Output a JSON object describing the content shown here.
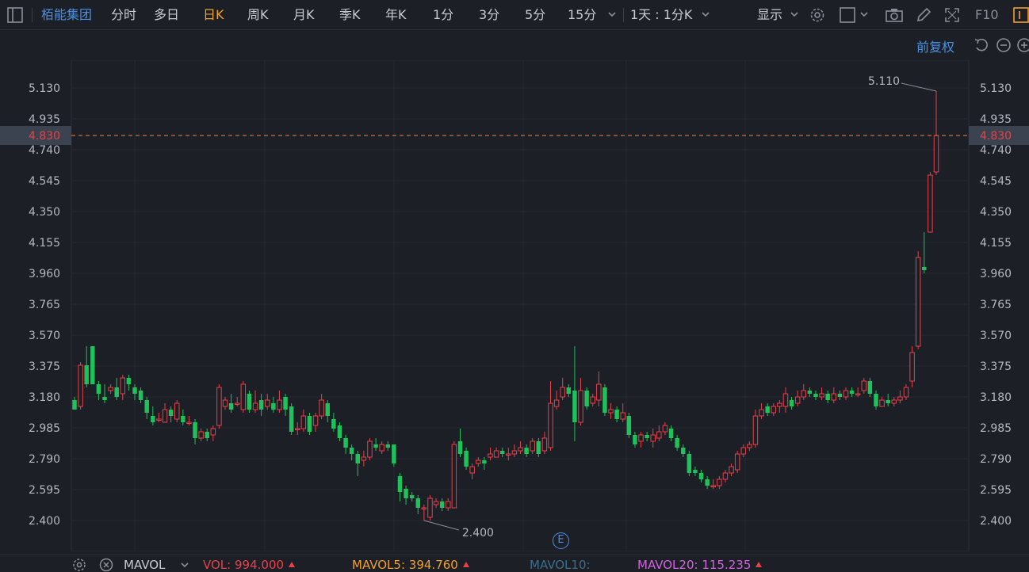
{
  "toolbar": {
    "stock_name": "栢能集团",
    "periods": [
      "分时",
      "多日",
      "日K",
      "周K",
      "月K",
      "季K",
      "年K",
      "1分",
      "3分",
      "5分",
      "15分"
    ],
    "active_period": "日K",
    "interval_label": "1天 : 1分K",
    "display_label": "显示",
    "f10_label": "F10"
  },
  "subbar": {
    "adjust_label": "前复权"
  },
  "price_axis": {
    "labels": [
      "5.130",
      "4.935",
      "4.740",
      "4.545",
      "4.350",
      "4.155",
      "3.960",
      "3.765",
      "3.570",
      "3.375",
      "3.180",
      "2.985",
      "2.790",
      "2.595",
      "2.400"
    ],
    "current_price": "4.830",
    "high_marker": "5.110",
    "low_marker": "2.400"
  },
  "event_marker": "E",
  "volume_bar": {
    "indicator": "MAVOL",
    "vol_label": "VOL:",
    "vol_value": "994.000",
    "mavol5_label": "MAVOL5:",
    "mavol5_value": "394.760",
    "mavol10_label": "MAVOL10:",
    "mavol20_label": "MAVOL20:",
    "mavol20_value": "115.235"
  },
  "colors": {
    "up": "#e8414a",
    "down": "#1fc15a",
    "active": "#f0a030",
    "link": "#4a90e2",
    "mavol5": "#f0a030",
    "mavol10": "#3c6e8c",
    "mavol20": "#d462e0"
  },
  "chart_data": {
    "type": "candlestick",
    "ylim": [
      2.3,
      5.2
    ],
    "candles": [
      [
        3.16,
        3.1,
        3.18,
        3.1
      ],
      [
        3.12,
        3.38,
        3.4,
        3.1
      ],
      [
        3.38,
        3.26,
        3.5,
        3.24
      ],
      [
        3.5,
        3.26,
        3.5,
        3.26
      ],
      [
        3.26,
        3.2,
        3.28,
        3.16
      ],
      [
        3.18,
        3.16,
        3.26,
        3.14
      ],
      [
        3.22,
        3.24,
        3.26,
        3.2
      ],
      [
        3.24,
        3.18,
        3.3,
        3.16
      ],
      [
        3.2,
        3.3,
        3.32,
        3.16
      ],
      [
        3.3,
        3.26,
        3.32,
        3.22
      ],
      [
        3.24,
        3.2,
        3.26,
        3.16
      ],
      [
        3.22,
        3.16,
        3.24,
        3.14
      ],
      [
        3.16,
        3.08,
        3.18,
        3.04
      ],
      [
        3.06,
        3.02,
        3.12,
        3.0
      ],
      [
        3.04,
        3.04,
        3.08,
        3.02
      ],
      [
        3.02,
        3.1,
        3.14,
        3.02
      ],
      [
        3.1,
        3.06,
        3.12,
        3.02
      ],
      [
        3.04,
        3.14,
        3.16,
        3.02
      ],
      [
        3.06,
        3.02,
        3.1,
        3.0
      ],
      [
        3.02,
        3.02,
        3.06,
        3.0
      ],
      [
        3.02,
        2.92,
        3.04,
        2.88
      ],
      [
        2.92,
        2.96,
        2.98,
        2.9
      ],
      [
        2.96,
        2.92,
        2.98,
        2.9
      ],
      [
        2.94,
        2.98,
        3.0,
        2.9
      ],
      [
        3.0,
        3.24,
        3.26,
        2.98
      ],
      [
        3.12,
        3.16,
        3.18,
        3.1
      ],
      [
        3.14,
        3.1,
        3.2,
        3.08
      ],
      [
        3.14,
        3.14,
        3.18,
        3.12
      ],
      [
        3.1,
        3.26,
        3.28,
        3.08
      ],
      [
        3.2,
        3.1,
        3.22,
        3.08
      ],
      [
        3.1,
        3.14,
        3.22,
        3.08
      ],
      [
        3.16,
        3.1,
        3.2,
        3.06
      ],
      [
        3.12,
        3.16,
        3.2,
        3.1
      ],
      [
        3.14,
        3.1,
        3.18,
        3.08
      ],
      [
        3.1,
        3.16,
        3.22,
        3.08
      ],
      [
        3.18,
        3.1,
        3.2,
        3.06
      ],
      [
        3.12,
        2.96,
        3.14,
        2.94
      ],
      [
        2.98,
        2.98,
        3.02,
        2.94
      ],
      [
        2.98,
        3.06,
        3.1,
        2.96
      ],
      [
        3.06,
        2.96,
        3.08,
        2.94
      ],
      [
        3.0,
        3.06,
        3.08,
        2.96
      ],
      [
        3.06,
        3.16,
        3.2,
        3.04
      ],
      [
        3.14,
        3.06,
        3.16,
        3.02
      ],
      [
        3.04,
        2.98,
        3.08,
        2.96
      ],
      [
        3.0,
        2.92,
        3.02,
        2.9
      ],
      [
        2.92,
        2.86,
        2.94,
        2.82
      ],
      [
        2.86,
        2.82,
        2.88,
        2.78
      ],
      [
        2.82,
        2.76,
        2.84,
        2.68
      ],
      [
        2.78,
        2.8,
        2.84,
        2.74
      ],
      [
        2.8,
        2.9,
        2.92,
        2.78
      ],
      [
        2.88,
        2.86,
        2.92,
        2.84
      ],
      [
        2.84,
        2.88,
        2.9,
        2.82
      ],
      [
        2.88,
        2.86,
        2.9,
        2.84
      ],
      [
        2.88,
        2.76,
        2.88,
        2.74
      ],
      [
        2.68,
        2.58,
        2.7,
        2.52
      ],
      [
        2.6,
        2.54,
        2.62,
        2.5
      ],
      [
        2.56,
        2.54,
        2.58,
        2.52
      ],
      [
        2.54,
        2.48,
        2.56,
        2.44
      ],
      [
        2.48,
        2.48,
        2.5,
        2.4
      ],
      [
        2.42,
        2.54,
        2.56,
        2.4
      ],
      [
        2.5,
        2.52,
        2.54,
        2.48
      ],
      [
        2.52,
        2.48,
        2.54,
        2.46
      ],
      [
        2.48,
        2.52,
        2.54,
        2.46
      ],
      [
        2.48,
        2.88,
        2.9,
        2.48
      ],
      [
        2.9,
        2.82,
        2.98,
        2.8
      ],
      [
        2.84,
        2.74,
        2.86,
        2.72
      ],
      [
        2.7,
        2.74,
        2.76,
        2.66
      ],
      [
        2.76,
        2.78,
        2.8,
        2.74
      ],
      [
        2.78,
        2.76,
        2.8,
        2.72
      ],
      [
        2.8,
        2.82,
        2.86,
        2.78
      ],
      [
        2.8,
        2.84,
        2.86,
        2.8
      ],
      [
        2.84,
        2.82,
        2.86,
        2.8
      ],
      [
        2.82,
        2.82,
        2.86,
        2.78
      ],
      [
        2.82,
        2.84,
        2.88,
        2.8
      ],
      [
        2.84,
        2.86,
        2.9,
        2.82
      ],
      [
        2.86,
        2.82,
        2.88,
        2.8
      ],
      [
        2.84,
        2.9,
        2.92,
        2.82
      ],
      [
        2.9,
        2.82,
        2.92,
        2.8
      ],
      [
        2.84,
        2.92,
        2.96,
        2.82
      ],
      [
        2.86,
        3.14,
        3.28,
        2.84
      ],
      [
        3.12,
        3.16,
        3.22,
        3.1
      ],
      [
        3.18,
        3.24,
        3.3,
        3.16
      ],
      [
        3.24,
        3.2,
        3.26,
        3.18
      ],
      [
        3.22,
        3.02,
        3.5,
        2.9
      ],
      [
        3.02,
        3.22,
        3.3,
        3.0
      ],
      [
        3.22,
        3.12,
        3.24,
        3.1
      ],
      [
        3.14,
        3.18,
        3.2,
        3.12
      ],
      [
        3.16,
        3.26,
        3.34,
        3.12
      ],
      [
        3.24,
        3.08,
        3.26,
        3.06
      ],
      [
        3.08,
        3.1,
        3.14,
        3.04
      ],
      [
        3.1,
        3.04,
        3.12,
        3.02
      ],
      [
        3.04,
        3.08,
        3.14,
        3.02
      ],
      [
        3.06,
        2.94,
        3.08,
        2.92
      ],
      [
        2.94,
        2.88,
        2.96,
        2.86
      ],
      [
        2.9,
        2.94,
        2.96,
        2.86
      ],
      [
        2.94,
        2.92,
        2.96,
        2.9
      ],
      [
        2.9,
        2.94,
        2.98,
        2.86
      ],
      [
        2.92,
        2.96,
        3.0,
        2.9
      ],
      [
        2.96,
        3.0,
        3.02,
        2.94
      ],
      [
        2.98,
        2.92,
        3.0,
        2.9
      ],
      [
        2.92,
        2.86,
        2.94,
        2.84
      ],
      [
        2.86,
        2.82,
        2.88,
        2.8
      ],
      [
        2.82,
        2.7,
        2.84,
        2.68
      ],
      [
        2.72,
        2.7,
        2.74,
        2.68
      ],
      [
        2.7,
        2.66,
        2.72,
        2.64
      ],
      [
        2.66,
        2.62,
        2.68,
        2.6
      ],
      [
        2.62,
        2.62,
        2.66,
        2.6
      ],
      [
        2.62,
        2.66,
        2.68,
        2.6
      ],
      [
        2.66,
        2.7,
        2.72,
        2.64
      ],
      [
        2.7,
        2.74,
        2.76,
        2.68
      ],
      [
        2.72,
        2.82,
        2.84,
        2.7
      ],
      [
        2.82,
        2.86,
        2.88,
        2.8
      ],
      [
        2.86,
        2.88,
        2.9,
        2.84
      ],
      [
        2.88,
        3.06,
        3.1,
        2.86
      ],
      [
        3.06,
        3.1,
        3.14,
        3.04
      ],
      [
        3.12,
        3.08,
        3.14,
        3.06
      ],
      [
        3.08,
        3.12,
        3.14,
        3.06
      ],
      [
        3.12,
        3.14,
        3.16,
        3.08
      ],
      [
        3.12,
        3.2,
        3.24,
        3.08
      ],
      [
        3.16,
        3.12,
        3.18,
        3.1
      ],
      [
        3.14,
        3.18,
        3.22,
        3.12
      ],
      [
        3.18,
        3.22,
        3.26,
        3.16
      ],
      [
        3.22,
        3.2,
        3.24,
        3.18
      ],
      [
        3.2,
        3.18,
        3.22,
        3.16
      ],
      [
        3.18,
        3.2,
        3.24,
        3.16
      ],
      [
        3.2,
        3.16,
        3.22,
        3.14
      ],
      [
        3.16,
        3.2,
        3.24,
        3.14
      ],
      [
        3.2,
        3.18,
        3.22,
        3.16
      ],
      [
        3.18,
        3.22,
        3.24,
        3.16
      ],
      [
        3.22,
        3.2,
        3.24,
        3.18
      ],
      [
        3.2,
        3.2,
        3.24,
        3.18
      ],
      [
        3.22,
        3.28,
        3.3,
        3.2
      ],
      [
        3.28,
        3.2,
        3.3,
        3.18
      ],
      [
        3.2,
        3.12,
        3.22,
        3.1
      ],
      [
        3.12,
        3.16,
        3.18,
        3.12
      ],
      [
        3.16,
        3.14,
        3.2,
        3.12
      ],
      [
        3.14,
        3.16,
        3.18,
        3.12
      ],
      [
        3.16,
        3.18,
        3.22,
        3.14
      ],
      [
        3.18,
        3.24,
        3.26,
        3.16
      ],
      [
        3.28,
        3.46,
        3.5,
        3.24
      ],
      [
        3.5,
        4.06,
        4.1,
        3.48
      ],
      [
        4.0,
        3.98,
        4.22,
        3.96
      ],
      [
        4.22,
        4.58,
        4.6,
        4.22
      ],
      [
        4.6,
        4.83,
        5.11,
        4.58
      ]
    ]
  }
}
